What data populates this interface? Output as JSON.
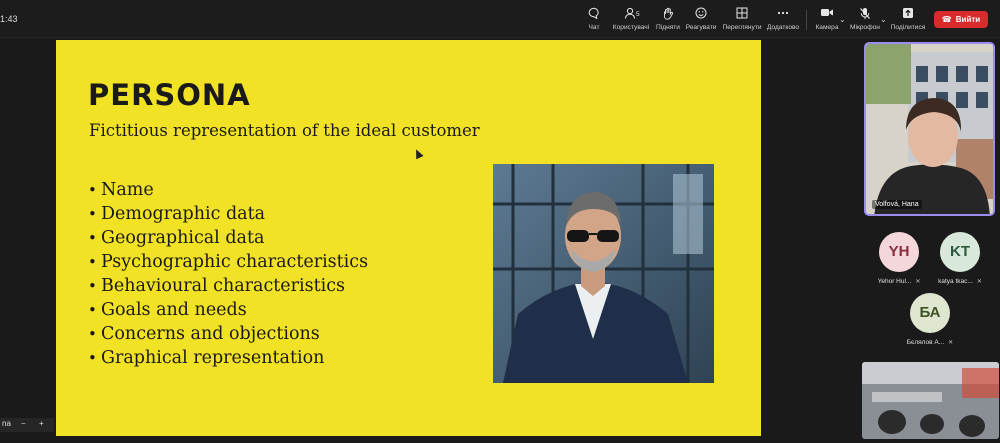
{
  "window": {
    "timer": "1:43",
    "leave_label": "Вийти"
  },
  "toolbar": {
    "items": [
      {
        "label": "Чат",
        "icon": "chat-icon"
      },
      {
        "label": "Користувачі",
        "icon": "people-icon",
        "count": "5"
      },
      {
        "label": "Підняти",
        "icon": "raise-hand-icon"
      },
      {
        "label": "Реагувати",
        "icon": "smile-icon"
      },
      {
        "label": "Переглянути",
        "icon": "grid-icon"
      },
      {
        "label": "Додатково",
        "icon": "more-icon"
      },
      {
        "label": "Камера",
        "icon": "camera-icon"
      },
      {
        "label": "Мікрофон",
        "icon": "mic-muted-icon"
      },
      {
        "label": "Поділитися",
        "icon": "share-icon"
      }
    ]
  },
  "slide": {
    "title": "PERSONA",
    "subtitle": "Fictitious representation of the ideal customer",
    "bullets": [
      "Name",
      "Demographic data",
      "Geographical data",
      "Psychographic characteristics",
      "Behavioural characteristics",
      "Goals and needs",
      "Concerns and objections",
      "Graphical representation"
    ]
  },
  "participants": {
    "speaker_name": "Volfová, Hana",
    "people": [
      {
        "initials": "YH",
        "name": "Yehor Hul...",
        "color": "#f3d7da",
        "text_color": "#8a2d3d"
      },
      {
        "initials": "KT",
        "name": "katya tkac...",
        "color": "#d8e8db",
        "text_color": "#2c5a3a"
      },
      {
        "initials": "БА",
        "name": "Бєлялов А...",
        "color": "#dfe6cf",
        "text_color": "#3f5126"
      }
    ]
  },
  "zoom": {
    "label": "na",
    "minus": "−",
    "plus": "+"
  },
  "colors": {
    "slide_bg": "#f2e225",
    "leave_button": "#d92b2b",
    "active_border": "#9b8cf0"
  }
}
